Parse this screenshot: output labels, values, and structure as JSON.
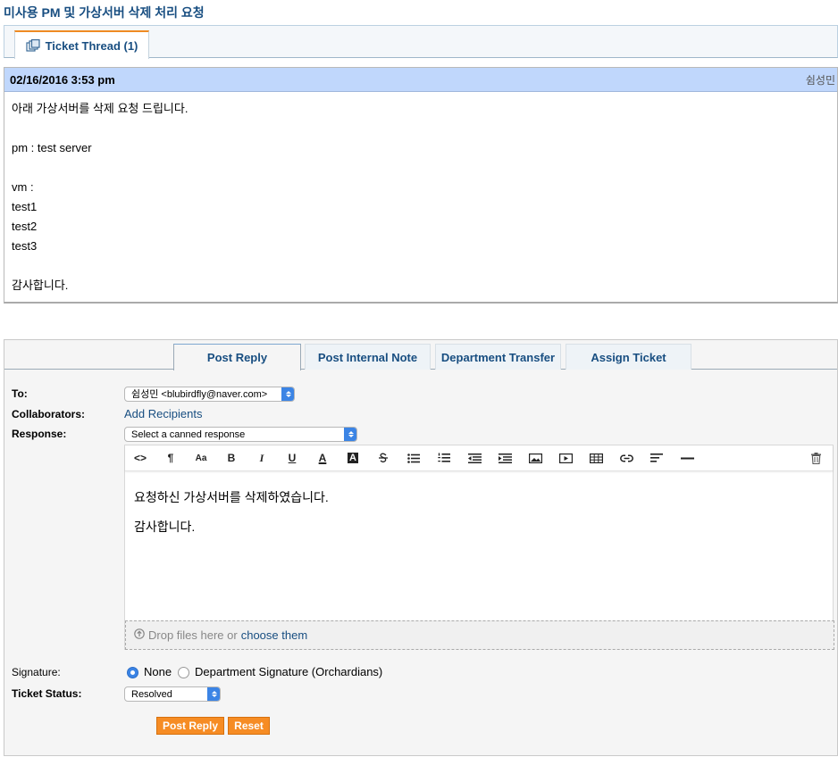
{
  "page": {
    "title": "미사용 PM 및 가상서버 삭제 처리 요청"
  },
  "thread_tab": {
    "label": "Ticket Thread (1)"
  },
  "entry": {
    "date": "02/16/2016 3:53 pm",
    "poster": "쉼성민",
    "lines": [
      "아래 가상서버를 삭제 요청 드립니다.",
      "",
      "pm : test server",
      "",
      "vm :",
      "test1",
      "test2",
      "test3",
      "",
      "감사합니다."
    ]
  },
  "response_tabs": [
    "Post Reply",
    "Post Internal Note",
    "Department Transfer",
    "Assign Ticket"
  ],
  "form": {
    "to_label": "To:",
    "to_value": "쉼성민 <blubirdfly@naver.com>",
    "collaborators_label": "Collaborators:",
    "add_recipients": "Add Recipients",
    "response_label": "Response:",
    "canned_placeholder": "Select a canned response",
    "editor_paragraphs": [
      "요청하신 가상서버를 삭제하였습니다.",
      "감사합니다."
    ],
    "dropzone_text": "Drop files here or",
    "dropzone_link": "choose them",
    "signature_label": "Signature:",
    "signature_none": "None",
    "signature_dept": "Department Signature (Orchardians)",
    "status_label": "Ticket Status:",
    "status_value": "Resolved",
    "post_reply": "Post Reply",
    "reset": "Reset"
  },
  "toolbar": {
    "icons": [
      "code-view-icon",
      "paragraph-icon",
      "font-size-icon",
      "bold-icon",
      "italic-icon",
      "underline-icon",
      "font-color-icon",
      "background-color-icon",
      "strikethrough-icon",
      "unordered-list-icon",
      "ordered-list-icon",
      "outdent-icon",
      "indent-icon",
      "image-icon",
      "video-icon",
      "table-icon",
      "link-icon",
      "align-icon",
      "horizontal-rule-icon",
      "trash-icon"
    ],
    "glyphs": {
      "code": "<>",
      "paragraph": "¶",
      "font_size": "Aa",
      "bold": "B",
      "italic": "I",
      "underline": "U",
      "font_color": "A",
      "bg_color": "A"
    }
  },
  "colors": {
    "accent": "#184e81",
    "button": "#f68c24",
    "header_bg": "#c0d7fc",
    "tab_highlight": "#ef8a22"
  }
}
